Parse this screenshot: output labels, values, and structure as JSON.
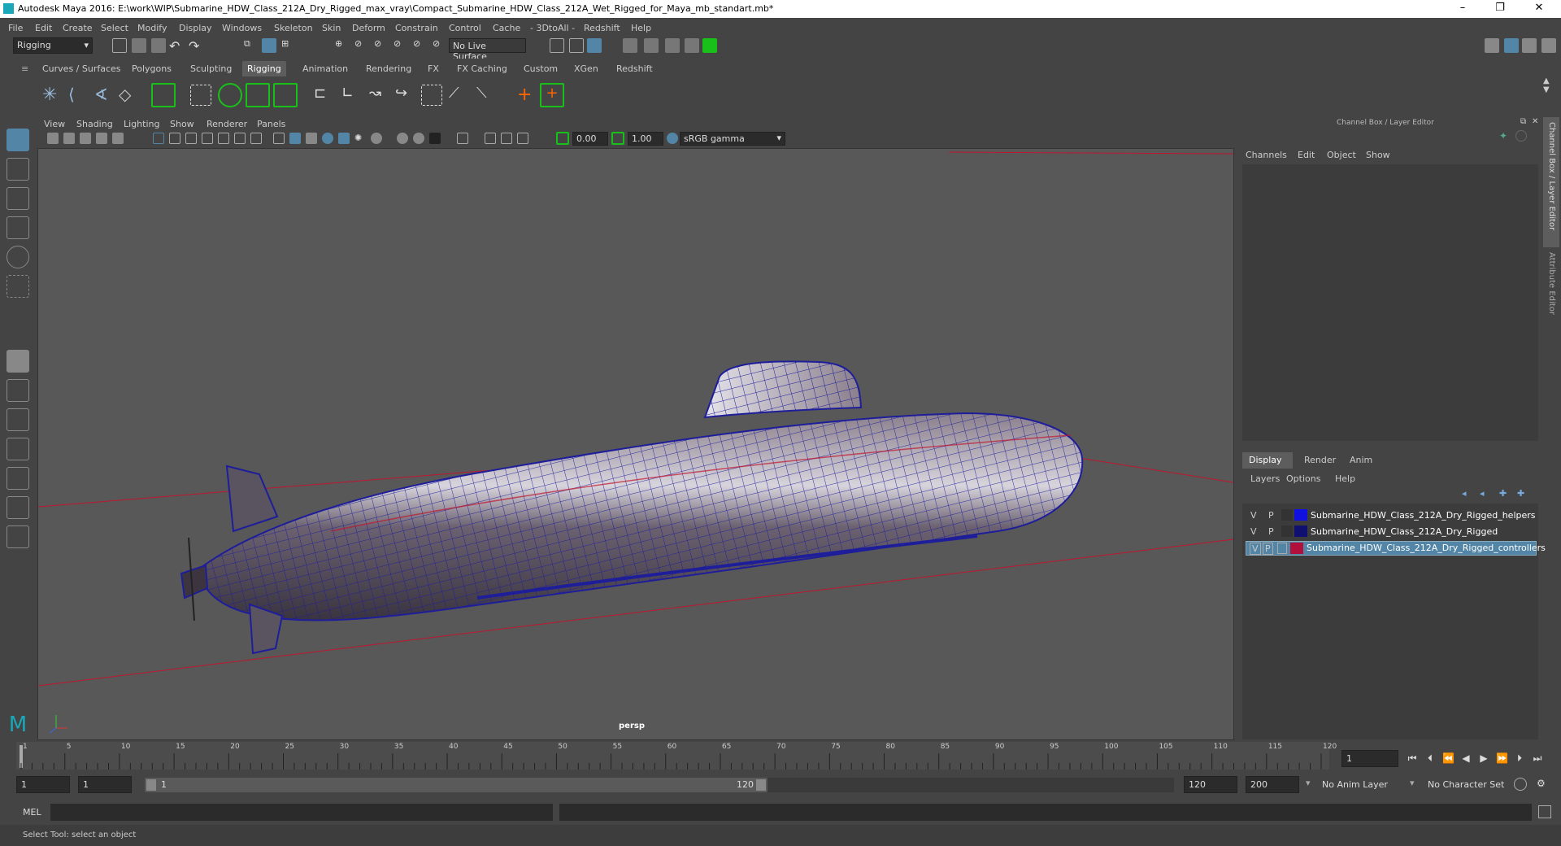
{
  "window": {
    "title": "Autodesk Maya 2016: E:\\work\\WIP\\Submarine_HDW_Class_212A_Dry_Rigged_max_vray\\Compact_Submarine_HDW_Class_212A_Wet_Rigged_for_Maya_mb_standart.mb*",
    "minimize": "–",
    "maximize": "❐",
    "close": "✕"
  },
  "menubar": [
    "File",
    "Edit",
    "Create",
    "Select",
    "Modify",
    "Display",
    "Windows",
    "Skeleton",
    "Skin",
    "Deform",
    "Constrain",
    "Control",
    "Cache",
    "- 3DtoAll -",
    "Redshift",
    "Help"
  ],
  "status_line": {
    "menuset": "Rigging",
    "live_surface": "No Live Surface"
  },
  "shelf_tabs": [
    "Curves / Surfaces",
    "Polygons",
    "Sculpting",
    "Rigging",
    "Animation",
    "Rendering",
    "FX",
    "FX Caching",
    "Custom",
    "XGen",
    "Redshift"
  ],
  "shelf_active": "Rigging",
  "viewport": {
    "menus": [
      "View",
      "Shading",
      "Lighting",
      "Show",
      "Renderer",
      "Panels"
    ],
    "exposure": "0.00",
    "gamma": "1.00",
    "colorspace": "sRGB gamma",
    "camera_label": "persp"
  },
  "channel_box": {
    "title": "Channel Box / Layer Editor",
    "menus": [
      "Channels",
      "Edit",
      "Object",
      "Show"
    ],
    "side_tab_1": "Channel Box / Layer Editor",
    "side_tab_2": "Attribute Editor"
  },
  "layer_editor": {
    "tabs": [
      "Display",
      "Render",
      "Anim"
    ],
    "active_tab": "Display",
    "menus": [
      "Layers",
      "Options",
      "Help"
    ],
    "layers": [
      {
        "v": "V",
        "p": "P",
        "color": "#1010e0",
        "name": "Submarine_HDW_Class_212A_Dry_Rigged_helpers",
        "selected": false
      },
      {
        "v": "V",
        "p": "P",
        "color": "#101070",
        "name": "Submarine_HDW_Class_212A_Dry_Rigged",
        "selected": false
      },
      {
        "v": "V",
        "p": "P",
        "color": "#b0103a",
        "name": "Submarine_HDW_Class_212A_Dry_Rigged_controllers",
        "selected": true
      }
    ]
  },
  "timeline": {
    "ticks": [
      "1",
      "5",
      "10",
      "15",
      "20",
      "25",
      "30",
      "35",
      "40",
      "45",
      "50",
      "55",
      "60",
      "65",
      "70",
      "75",
      "80",
      "85",
      "90",
      "95",
      "100",
      "105",
      "110",
      "115",
      "120"
    ],
    "current_frame": "1"
  },
  "range": {
    "start": "1",
    "playback_start": "1",
    "slider_start": "1",
    "slider_end": "120",
    "playback_end": "120",
    "end": "200",
    "anim_layer": "No Anim Layer",
    "character_set": "No Character Set"
  },
  "command_line": {
    "label": "MEL"
  },
  "help_line": {
    "text": "Select Tool: select an object"
  },
  "colors": {
    "accent": "#5285a6",
    "active_green": "#19c019",
    "wire": "#1e1e9a",
    "grid_red": "#c0162f"
  }
}
